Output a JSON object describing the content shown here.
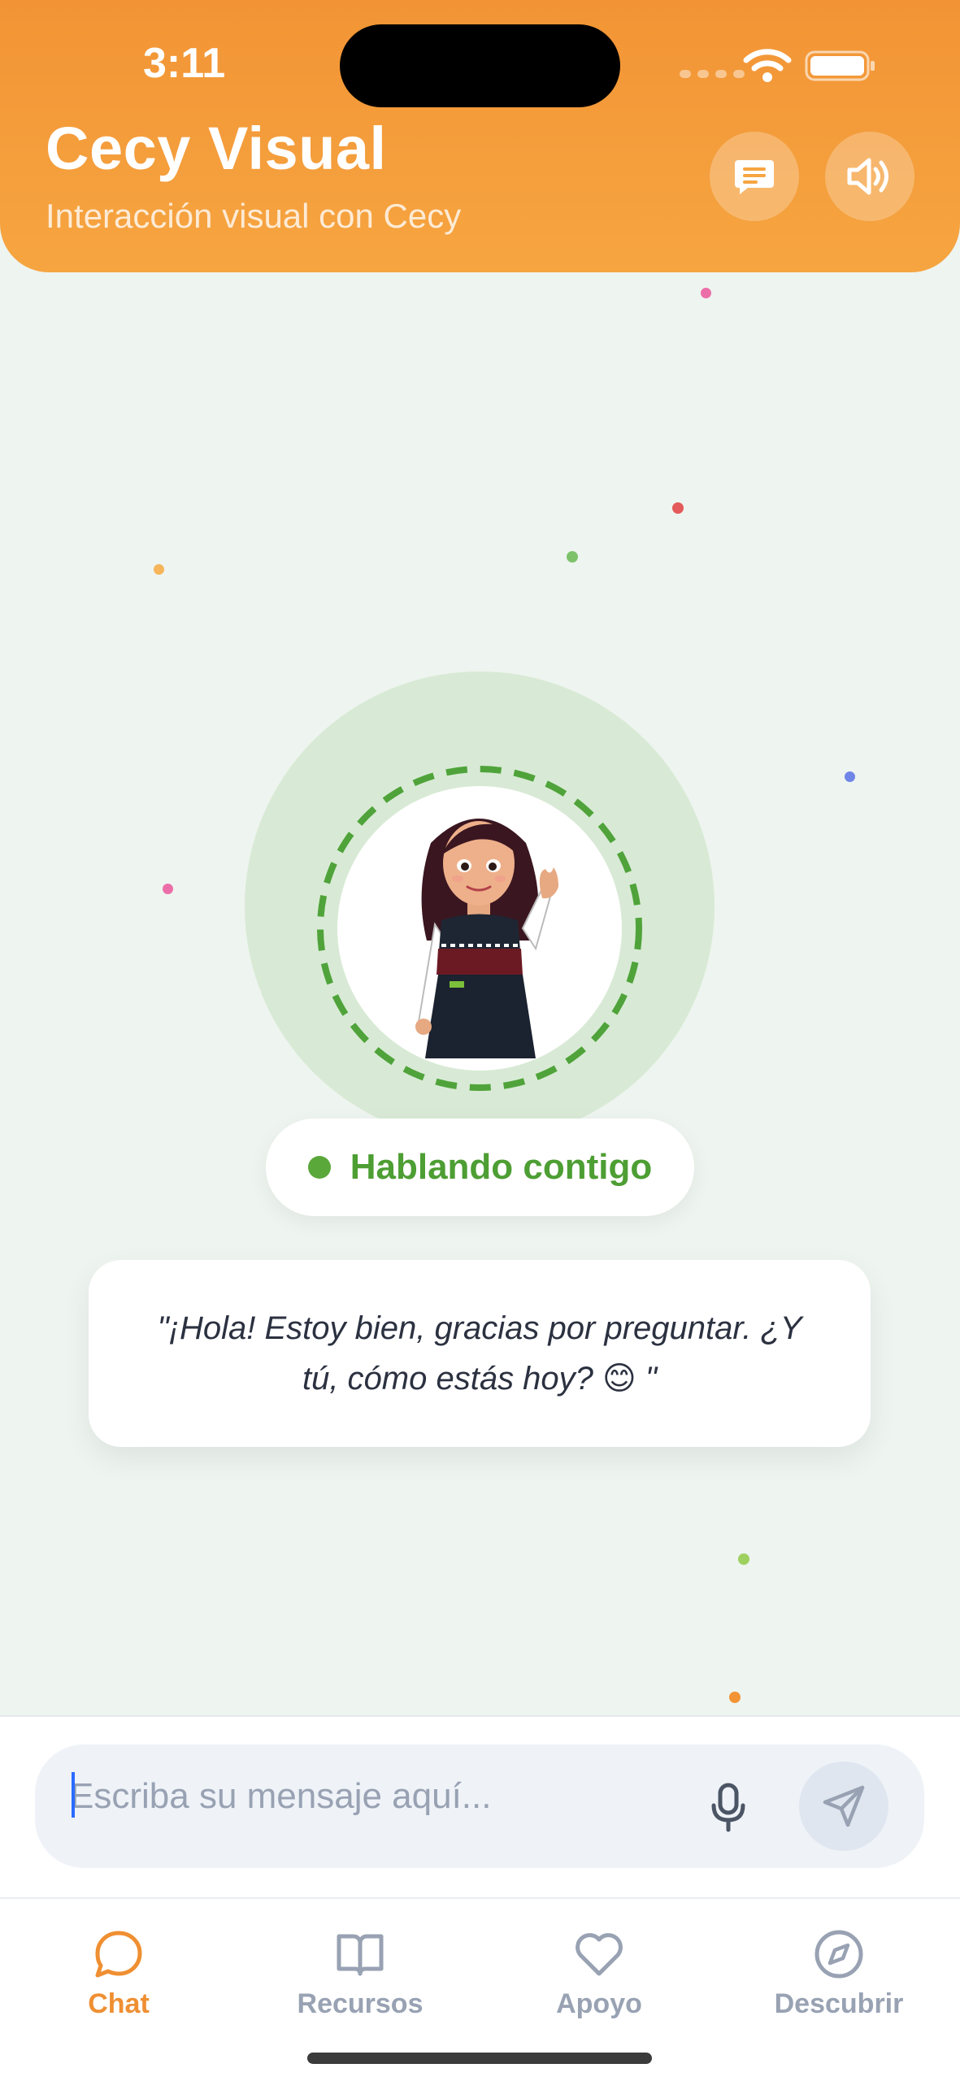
{
  "status_bar": {
    "time": "3:11"
  },
  "header": {
    "title": "Cecy Visual",
    "subtitle": "Interacción visual con Cecy",
    "chat_button_icon": "message-square-icon",
    "sound_button_icon": "volume-icon"
  },
  "avatar": {
    "status_text": "Hablando contigo",
    "status_color": "#5aa83a",
    "speech": "\"¡Hola! Estoy bien, gracias por preguntar. ¿Y tú, cómo estás hoy? 😊 \""
  },
  "composer": {
    "placeholder": "Escriba su mensaje aquí...",
    "value": "",
    "mic_icon": "microphone-icon",
    "send_icon": "send-icon"
  },
  "tabs": [
    {
      "label": "Chat",
      "icon": "chat-bubble-icon",
      "active": true
    },
    {
      "label": "Recursos",
      "icon": "book-open-icon",
      "active": false
    },
    {
      "label": "Apoyo",
      "icon": "heart-icon",
      "active": false
    },
    {
      "label": "Descubrir",
      "icon": "compass-icon",
      "active": false
    }
  ],
  "colors": {
    "header_gradient_top": "#f29435",
    "header_gradient_bottom": "#f6a541",
    "accent": "#ef8f32",
    "background": "#eef4ef",
    "inactive": "#98a2b3"
  }
}
